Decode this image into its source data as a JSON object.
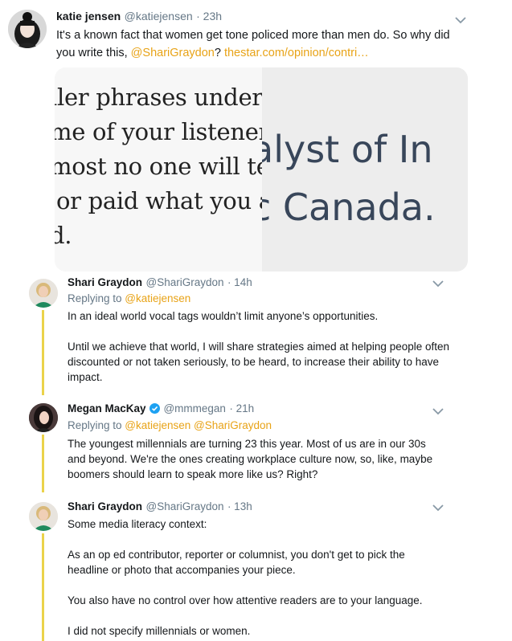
{
  "tweets": [
    {
      "name": "katie jensen",
      "handle": "@katiejensen",
      "time": "· 23h",
      "text_before": "It's a known fact that women get tone policed more than men do. So why did you write this, ",
      "mention": "@ShariGraydon",
      "text_mid": "? ",
      "url": "thestar.com/opinion/contri…",
      "avatar_icon": "woman-portrait-avatar",
      "media": {
        "left_lines": [
          "ller phrases underm",
          "me of your listeners",
          "most no one will tel",
          "or paid what you as",
          "d."
        ],
        "right_lines": [
          "alyst of In",
          "c Canada."
        ]
      }
    },
    {
      "name": "Shari Graydon",
      "handle": "@ShariGraydon",
      "time": "· 14h",
      "replying_label": "Replying to ",
      "replying_handle": "@katiejensen",
      "paragraph1": "In an ideal world vocal tags wouldn’t limit anyone’s opportunities.",
      "paragraph2": "Until we achieve that world, I will share strategies aimed at helping people often discounted or not taken seriously, to be heard, to increase their ability to have impact."
    },
    {
      "name": "Megan MacKay",
      "handle": "@mmmegan",
      "time": "· 21h",
      "verified_icon": "verified-badge-icon",
      "replying_label": "Replying to ",
      "replying_handles": "@katiejensen @ShariGraydon",
      "paragraph1": "The youngest millennials are turning 23 this year. Most of us are in our 30s and beyond. We're the ones creating workplace culture now, so, like, maybe boomers should learn to speak more like us? Right?"
    },
    {
      "name": "Shari Graydon",
      "handle": "@ShariGraydon",
      "time": "· 13h",
      "paragraph0": "Some media literacy context:",
      "paragraph1": "As an op ed contributor, reporter or columnist, you don't get to pick the headline or photo that accompanies your piece.",
      "paragraph2": "You also have no control over how attentive readers are to your language.",
      "paragraph3": "I did not specify millennials or women."
    }
  ],
  "colors": {
    "link": "#e8a317",
    "thread_line": "#ebd34a",
    "muted": "#657786"
  }
}
